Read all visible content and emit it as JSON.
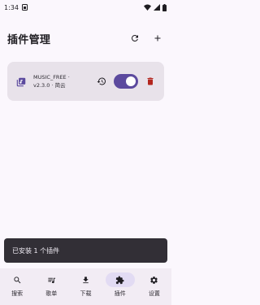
{
  "status_bar": {
    "time": "1:34",
    "left_icon": "sim-card-icon",
    "right_icons": [
      "wifi-icon",
      "signal-icon",
      "battery-icon"
    ]
  },
  "header": {
    "title": "插件管理",
    "actions": [
      "refresh-icon",
      "add-icon"
    ]
  },
  "plugin": {
    "name": "MUSIC_FREE ·",
    "meta": "v2.3.0 · 简云",
    "icon": "plugin-package-icon",
    "enabled": true,
    "actions": [
      "update-icon",
      "toggle",
      "delete-icon"
    ]
  },
  "snackbar": {
    "message": "已安装 1 个插件"
  },
  "bottom_nav": {
    "items": [
      {
        "label": "搜索",
        "icon": "search-icon",
        "active": false
      },
      {
        "label": "歌单",
        "icon": "playlist-icon",
        "active": false
      },
      {
        "label": "下载",
        "icon": "download-icon",
        "active": false
      },
      {
        "label": "插件",
        "icon": "puzzle-icon",
        "active": true
      },
      {
        "label": "设置",
        "icon": "gear-icon",
        "active": false
      }
    ]
  },
  "colors": {
    "background": "#fbf7fd",
    "card": "#e8e2ea",
    "accent": "#5c4a9e",
    "delete": "#b3261e",
    "snackbar": "#322f36",
    "nav_active_pill": "#e2dbf3"
  }
}
